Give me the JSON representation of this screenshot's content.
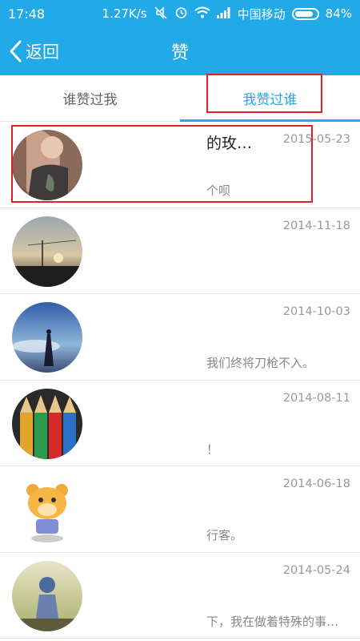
{
  "status_bar": {
    "time": "17:48",
    "speed": "1.27K/s",
    "carrier": "中国移动",
    "battery": "84%"
  },
  "nav": {
    "back_label": "返回",
    "title": "赞"
  },
  "tabs": [
    {
      "label": "谁赞过我",
      "active": false
    },
    {
      "label": "我赞过谁",
      "active": true
    }
  ],
  "items": [
    {
      "title": "的玫…",
      "date": "2015-05-23",
      "snippet": "个呗"
    },
    {
      "title": "",
      "date": "2014-11-18",
      "snippet": ""
    },
    {
      "title": "",
      "date": "2014-10-03",
      "snippet": "我们终将刀枪不入。"
    },
    {
      "title": "",
      "date": "2014-08-11",
      "snippet": "！"
    },
    {
      "title": "",
      "date": "2014-06-18",
      "snippet": "行客。"
    },
    {
      "title": "",
      "date": "2014-05-24",
      "snippet": "下，我在做着特殊的事…"
    }
  ],
  "colors": {
    "accent": "#21a9e8",
    "highlight": "#e0202a"
  }
}
